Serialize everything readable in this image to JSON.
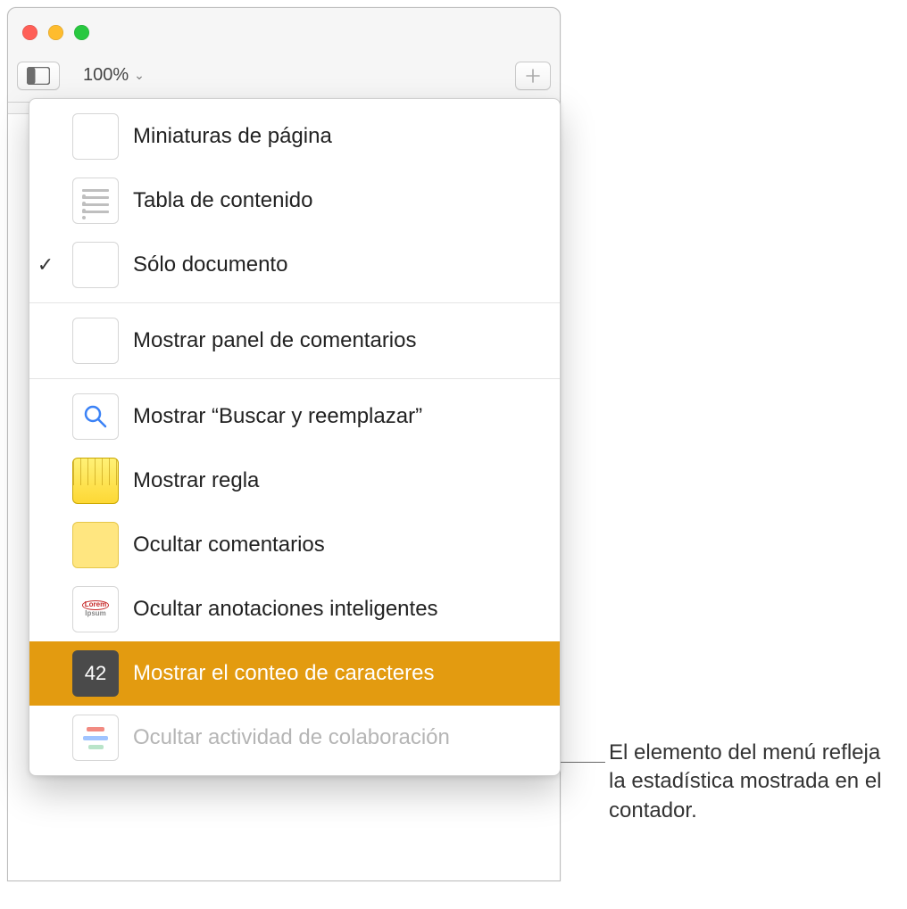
{
  "toolbar": {
    "zoom": "100%"
  },
  "menu": {
    "items": [
      {
        "label": "Miniaturas de página"
      },
      {
        "label": "Tabla de contenido"
      },
      {
        "label": "Sólo documento"
      },
      {
        "label": "Mostrar panel de comentarios"
      },
      {
        "label": "Mostrar “Buscar y reemplazar”"
      },
      {
        "label": "Mostrar regla"
      },
      {
        "label": "Ocultar comentarios"
      },
      {
        "label": "Ocultar anotaciones inteligentes"
      },
      {
        "label": "Mostrar el conteo de caracteres"
      },
      {
        "label": "Ocultar actividad de colaboración"
      }
    ],
    "count_icon_value": "42",
    "checkmark": "✓"
  },
  "callout": {
    "text": "El elemento del menú refleja la estadística mostrada en el contador."
  }
}
